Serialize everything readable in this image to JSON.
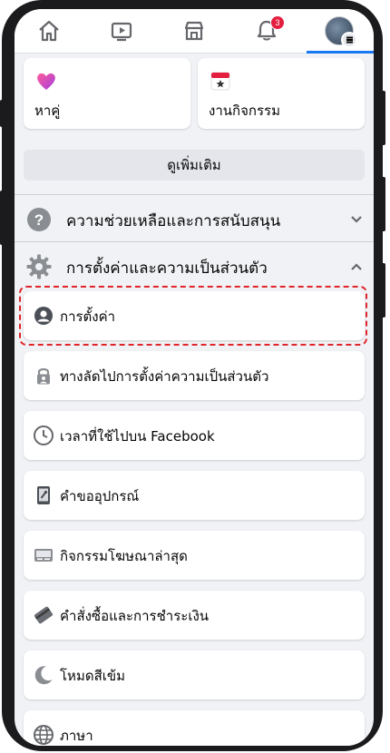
{
  "nav": {
    "icons": [
      "home-icon",
      "video-icon",
      "marketplace-icon",
      "bell-icon",
      "profile-menu-icon"
    ],
    "notification_count": "3",
    "active_color": "#1877f2"
  },
  "shortcuts": {
    "dating_label": "หาคู่",
    "events_label": "งานกิจกรรม",
    "see_more_label": "ดูเพิ่มเติม"
  },
  "sections": {
    "help_label": "ความช่วยเหลือและการสนับสนุน",
    "settings_privacy_label": "การตั้งค่าและความเป็นส่วนตัว"
  },
  "settings_items": [
    {
      "label": "การตั้งค่า",
      "icon": "person-circle-icon"
    },
    {
      "label": "ทางลัดไปการตั้งค่าความเป็นส่วนตัว",
      "icon": "lock-icon"
    },
    {
      "label": "เวลาที่ใช้ไปบน Facebook",
      "icon": "clock-icon"
    },
    {
      "label": "คำขออุปกรณ์",
      "icon": "phone-device-icon"
    },
    {
      "label": "กิจกรรมโฆษณาล่าสุด",
      "icon": "ad-activity-icon"
    },
    {
      "label": "คำสั่งซื้อและการชำระเงิน",
      "icon": "card-icon"
    },
    {
      "label": "โหมดสีเข้ม",
      "icon": "moon-icon"
    },
    {
      "label": "ภาษา",
      "icon": "globe-icon"
    }
  ],
  "highlight_color": "#e0242a"
}
